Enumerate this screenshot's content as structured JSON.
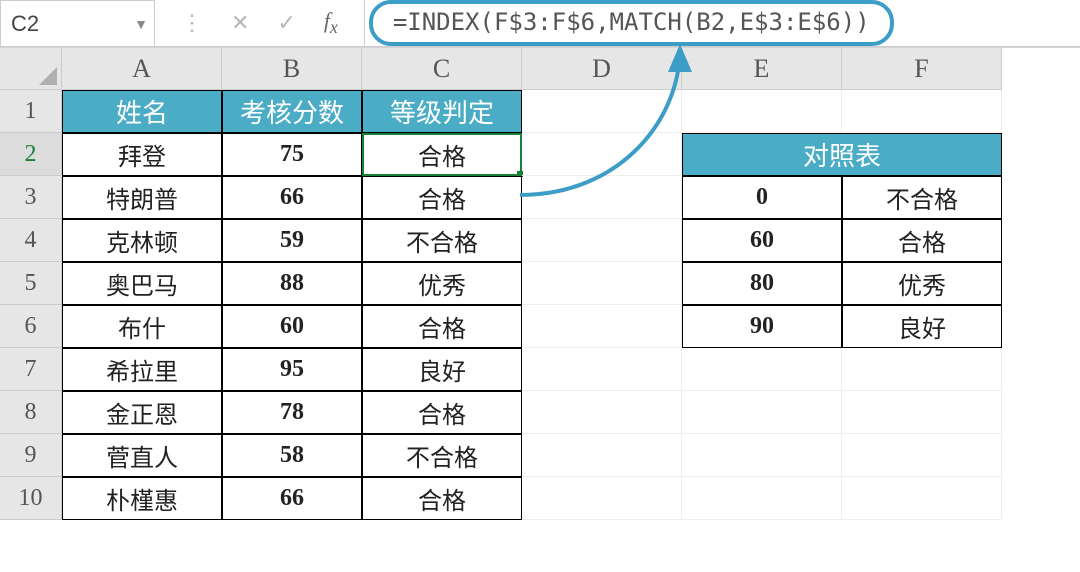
{
  "formula_bar": {
    "name_box": "C2",
    "formula": "=INDEX(F$3:F$6,MATCH(B2,E$3:E$6))"
  },
  "columns": [
    "A",
    "B",
    "C",
    "D",
    "E",
    "F"
  ],
  "row_numbers": [
    "1",
    "2",
    "3",
    "4",
    "5",
    "6",
    "7",
    "8",
    "9",
    "10"
  ],
  "main_table": {
    "headers": {
      "name": "姓名",
      "score": "考核分数",
      "grade": "等级判定"
    },
    "rows": [
      {
        "name": "拜登",
        "score": "75",
        "grade": "合格"
      },
      {
        "name": "特朗普",
        "score": "66",
        "grade": "合格"
      },
      {
        "name": "克林顿",
        "score": "59",
        "grade": "不合格"
      },
      {
        "name": "奥巴马",
        "score": "88",
        "grade": "优秀"
      },
      {
        "name": "布什",
        "score": "60",
        "grade": "合格"
      },
      {
        "name": "希拉里",
        "score": "95",
        "grade": "良好"
      },
      {
        "name": "金正恩",
        "score": "78",
        "grade": "合格"
      },
      {
        "name": "菅直人",
        "score": "58",
        "grade": "不合格"
      },
      {
        "name": "朴槿惠",
        "score": "66",
        "grade": "合格"
      }
    ]
  },
  "lookup_table": {
    "title": "对照表",
    "rows": [
      {
        "threshold": "0",
        "label": "不合格"
      },
      {
        "threshold": "60",
        "label": "合格"
      },
      {
        "threshold": "80",
        "label": "优秀"
      },
      {
        "threshold": "90",
        "label": "良好"
      }
    ]
  }
}
